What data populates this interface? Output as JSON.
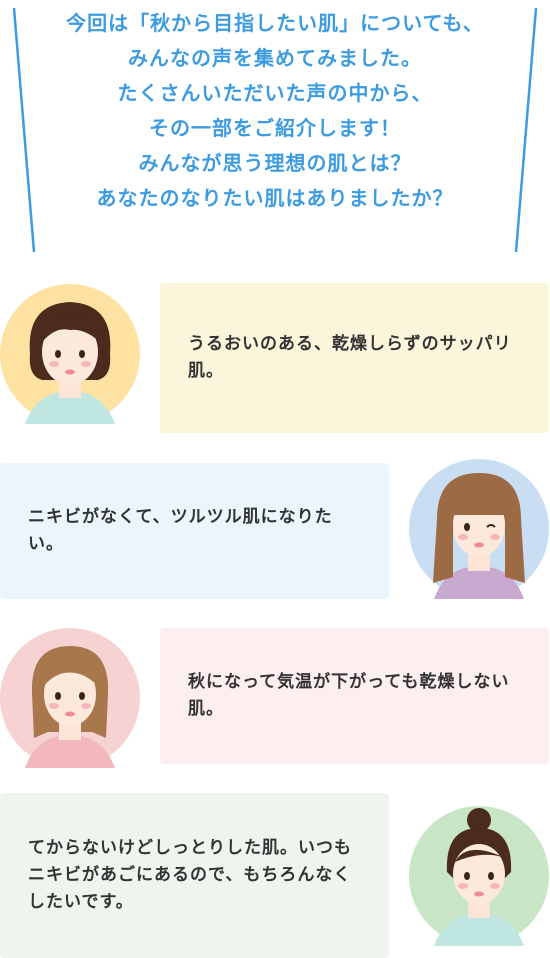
{
  "intro": {
    "lines": [
      "今回は「秋から目指したい肌」についても、",
      "みんなの声を集めてみました。",
      "たくさんいただいた声の中から、",
      "その一部をご紹介します！",
      "みんなが思う理想の肌とは？",
      "あなたのなりたい肌はありましたか？"
    ],
    "color": "#3d9be0"
  },
  "comments": [
    {
      "text": "うるおいのある、乾燥しらずのサッパリ肌。",
      "bubble_color": "#fbf5dc",
      "avatar_bg": "#fde2a1",
      "avatar_side": "left",
      "hair": "dark-brown-bob"
    },
    {
      "text": "ニキビがなくて、ツルツル肌になりたい。",
      "bubble_color": "#eaf5fc",
      "avatar_bg": "#c9def3",
      "avatar_side": "right",
      "hair": "long-brown-bangs"
    },
    {
      "text": "秋になって気温が下がっても乾燥しない肌。",
      "bubble_color": "#fdeff0",
      "avatar_bg": "#f7d2d3",
      "avatar_side": "left",
      "hair": "light-brown-bob"
    },
    {
      "text": "てからないけどしっとりした肌。いつもニキビがあごにあるので、もちろんなくしたいです。",
      "bubble_color": "#eef4ee",
      "avatar_bg": "#c8e6c5",
      "avatar_side": "right",
      "hair": "bun-winking"
    }
  ]
}
